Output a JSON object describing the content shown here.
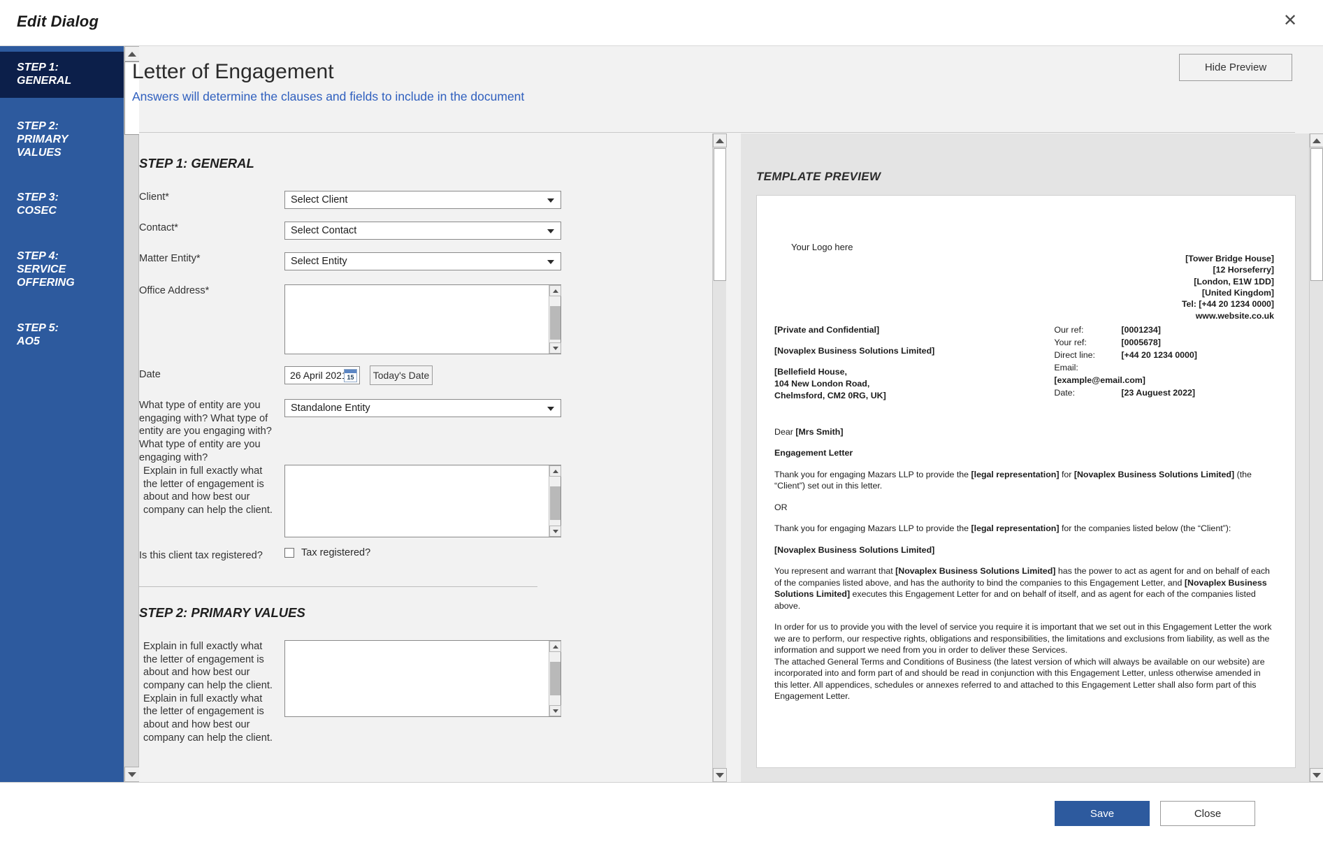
{
  "window": {
    "title": "Edit Dialog",
    "close_icon": "close-icon"
  },
  "sidebar": {
    "items": [
      {
        "label": "STEP 1:\nGENERAL",
        "active": true
      },
      {
        "label": "STEP 2:\nPRIMARY\nVALUES",
        "active": false
      },
      {
        "label": "STEP 3:\nCOSEC",
        "active": false
      },
      {
        "label": "STEP 4:\nSERVICE\nOFFERING",
        "active": false
      },
      {
        "label": "STEP 5:\nAO5",
        "active": false
      }
    ]
  },
  "header": {
    "title": "Letter of Engagement",
    "subtitle": "Answers will determine the clauses and fields to include in the document",
    "hide_preview_label": "Hide Preview"
  },
  "form": {
    "step1_heading": "STEP 1: GENERAL",
    "step2_heading": "STEP 2: PRIMARY VALUES",
    "fields": {
      "client_label": "Client*",
      "client_value": "Select Client",
      "contact_label": "Contact*",
      "contact_value": "Select Contact",
      "matter_entity_label": "Matter Entity*",
      "matter_entity_value": "Select Entity",
      "office_address_label": "Office Address*",
      "office_address_value": "",
      "date_label": "Date",
      "date_value": "26 April 2021",
      "calendar_icon_day": "15",
      "todays_date_label": "Today's Date",
      "entity_type_label": "What type of entity are you engaging with? What type of entity are you engaging with? What type of entity are you engaging with?",
      "entity_type_value": "Standalone Entity",
      "explain_label": "Explain in full exactly what the letter of engagement is about and how best our company can help the client.",
      "explain_value": "",
      "tax_label": "Is this client tax registered?",
      "tax_checkbox_label": "Tax registered?",
      "tax_checked": false,
      "step2_explain_label": "Explain in full exactly what the letter of engagement is about and how best our company can help the client. Explain in full exactly what the letter of engagement is about and how best our company can help the client.",
      "step2_explain_value": ""
    }
  },
  "preview": {
    "label": "TEMPLATE PREVIEW",
    "logo_placeholder": "Your Logo here",
    "letterhead": [
      "[Tower Bridge House]",
      "[12 Horseferry]",
      "[London, E1W 1DD]",
      "[United Kingdom]",
      "Tel: [+44 20 1234 0000]",
      "www.website.co.uk"
    ],
    "confidential": "[Private and Confidential]",
    "recipient_company": "[Novaplex Business Solutions Limited]",
    "recipient_address": [
      "[Bellefield House,",
      "104 New London Road,",
      "Chelmsford, CM2 0RG, UK]"
    ],
    "refs": [
      {
        "key": "Our ref:",
        "value": "[0001234]"
      },
      {
        "key": "Your ref:",
        "value": "[0005678]"
      },
      {
        "key": "Direct line:",
        "value": "[+44 20 1234 0000]"
      },
      {
        "key": "Email:",
        "value": ""
      },
      {
        "key": "[example@email.com]",
        "value": ""
      },
      {
        "key": "Date:",
        "value": "[23 Auguest 2022]"
      }
    ],
    "salutation_prefix": "Dear ",
    "salutation_name": "[Mrs Smith]",
    "subject": "Engagement Letter",
    "para1_a": "Thank you for engaging Mazars LLP to provide the ",
    "para1_b": "[legal representation]",
    "para1_c": " for ",
    "para1_d": "[Novaplex Business Solutions Limited]",
    "para1_e": " (the “Client”) set out in this letter.",
    "or_text": "OR",
    "para2_a": "Thank you for engaging Mazars LLP to provide the ",
    "para2_b": "[legal representation]",
    "para2_c": " for the companies listed below (the “Client”):",
    "company_line": "[Novaplex Business Solutions Limited]",
    "para3_a": "You represent and warrant that ",
    "para3_b": "[Novaplex Business Solutions Limited]",
    "para3_c": " has the power to act as agent for and on behalf of each of the companies listed above, and has the authority to bind the companies to this Engagement Letter, and ",
    "para3_d": "[Novaplex Business Solutions Limited]",
    "para3_e": " executes this Engagement Letter for and on behalf of itself, and as agent for each of the companies listed above.",
    "para4": "In order for us to provide you with the level of service you require it is important that we set out in this Engagement Letter the work we are to perform, our respective rights, obligations and responsibilities, the limitations and exclusions from liability, as well as the information and support we need from you in order to deliver these Services.",
    "para5": "The attached General Terms and Conditions of Business (the latest version of which will always be available on our website) are incorporated into and form part of and should be read in conjunction with this Engagement Letter, unless otherwise amended in this letter. All appendices, schedules or annexes referred to and attached to this Engagement Letter shall also form part of this Engagement Letter."
  },
  "footer": {
    "save_label": "Save",
    "close_label": "Close"
  },
  "colors": {
    "sidebar": "#2d5a9e",
    "sidebar_active": "#0c1f4a",
    "accent_link": "#2f5fbe",
    "primary_button": "#2d5a9e"
  }
}
